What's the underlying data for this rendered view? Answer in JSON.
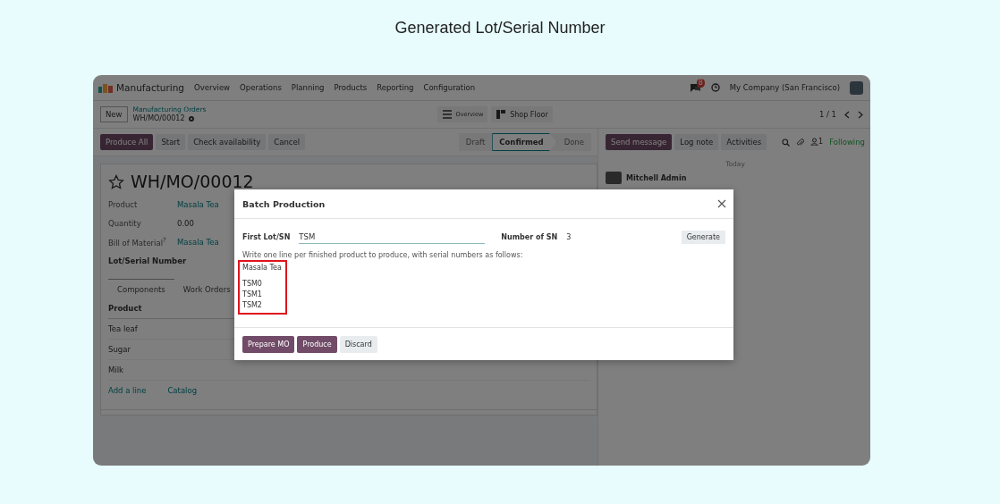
{
  "heading": "Generated Lot/Serial Number",
  "navbar": {
    "app": "Manufacturing",
    "menu": [
      "Overview",
      "Operations",
      "Planning",
      "Products",
      "Reporting",
      "Configuration"
    ],
    "message_count": "8",
    "company": "My Company (San Francisco)"
  },
  "control_panel": {
    "new_button": "New",
    "breadcrumb": "Manufacturing Orders",
    "record": "WH/MO/00012",
    "views": [
      {
        "label": "Overview",
        "kind": "list"
      },
      {
        "label": "Shop Floor",
        "kind": "floor"
      }
    ],
    "pager": "1 / 1"
  },
  "actions": [
    "Produce All",
    "Start",
    "Check availability",
    "Cancel"
  ],
  "stages": [
    {
      "label": "Draft",
      "selected": false
    },
    {
      "label": "Confirmed",
      "selected": true
    },
    {
      "label": "Done",
      "selected": false
    }
  ],
  "form": {
    "title": "WH/MO/00012",
    "fields": [
      {
        "label": "Product",
        "value": "Masala Tea",
        "kind": "link"
      },
      {
        "label": "Quantity",
        "value": "0.00",
        "kind": "text"
      },
      {
        "label": "Bill of Material$^{?}$",
        "value": "Masala Tea",
        "kind": "link"
      },
      {
        "label": "Lot/Serial Number",
        "kind": "heading"
      }
    ],
    "tabs": [
      {
        "label": "Components",
        "selected": true
      },
      {
        "label": "Work Orders",
        "selected": false
      }
    ],
    "table": {
      "columns": [
        "Product"
      ],
      "rows": [
        "Tea leaf",
        "Sugar",
        "Milk"
      ]
    },
    "links": [
      "Add a line",
      "Catalog"
    ]
  },
  "chatter": {
    "buttons": [
      {
        "label": "Send message",
        "kind": "primary"
      },
      {
        "label": "Log note",
        "kind": "plain"
      },
      {
        "label": "Activities",
        "kind": "plain"
      }
    ],
    "follower_count": "1",
    "following": "Following",
    "date": "Today",
    "author": "Mitchell Admin"
  },
  "dialog": {
    "title": "Batch Production",
    "first_lot_label": "First Lot/SN",
    "first_lot_value": "TSM",
    "count_label": "Number of SN",
    "count_value": "3",
    "generate": "Generate",
    "hint": "Write one line per finished product to produce, with serial numbers as follows:",
    "lines": [
      {
        "text": "Masala Tea",
        "kind": "product"
      },
      {
        "text": "TSM0",
        "kind": "serial"
      },
      {
        "text": "TSM1",
        "kind": "serial"
      },
      {
        "text": "TSM2",
        "kind": "serial"
      }
    ],
    "buttons": [
      {
        "label": "Prepare MO",
        "kind": "primary"
      },
      {
        "label": "Produce",
        "kind": "primary"
      },
      {
        "label": "Discard",
        "kind": "secondary"
      }
    ]
  }
}
